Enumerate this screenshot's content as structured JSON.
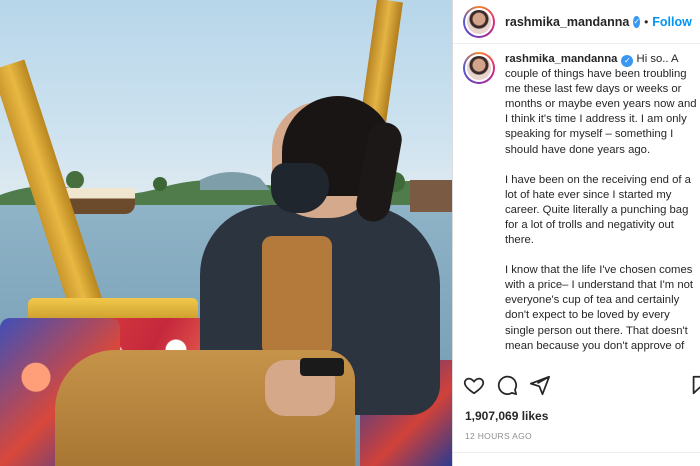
{
  "post": {
    "username": "rashmika_mandanna",
    "follow_label": "Follow",
    "header_separator": "•",
    "caption_paragraphs": [
      "Hi so.. A couple of things have been troubling me these last few days or weeks or months or maybe even years now and I think it's time I address it. I am only speaking for myself – something I should have done years ago.",
      "I have been on the receiving end of a lot of hate ever since I started my career. Quite literally a punching bag for a lot of trolls and negativity out there.",
      "I know that the life I've chosen comes with a price– I understand that I'm not everyone's cup of tea and certainly don't expect to be loved by every single person out there. That doesn't mean because you don't approve of"
    ],
    "likes_text": "1,907,069 likes",
    "timestamp": "12 HOURS AGO"
  },
  "icons": {
    "verified": "verified-badge-icon",
    "like": "heart-icon",
    "comment": "comment-icon",
    "share": "share-icon",
    "save": "bookmark-icon"
  },
  "colors": {
    "follow": "#0095f6",
    "verified": "#3897f0",
    "secondary_text": "#8e8e8e"
  }
}
